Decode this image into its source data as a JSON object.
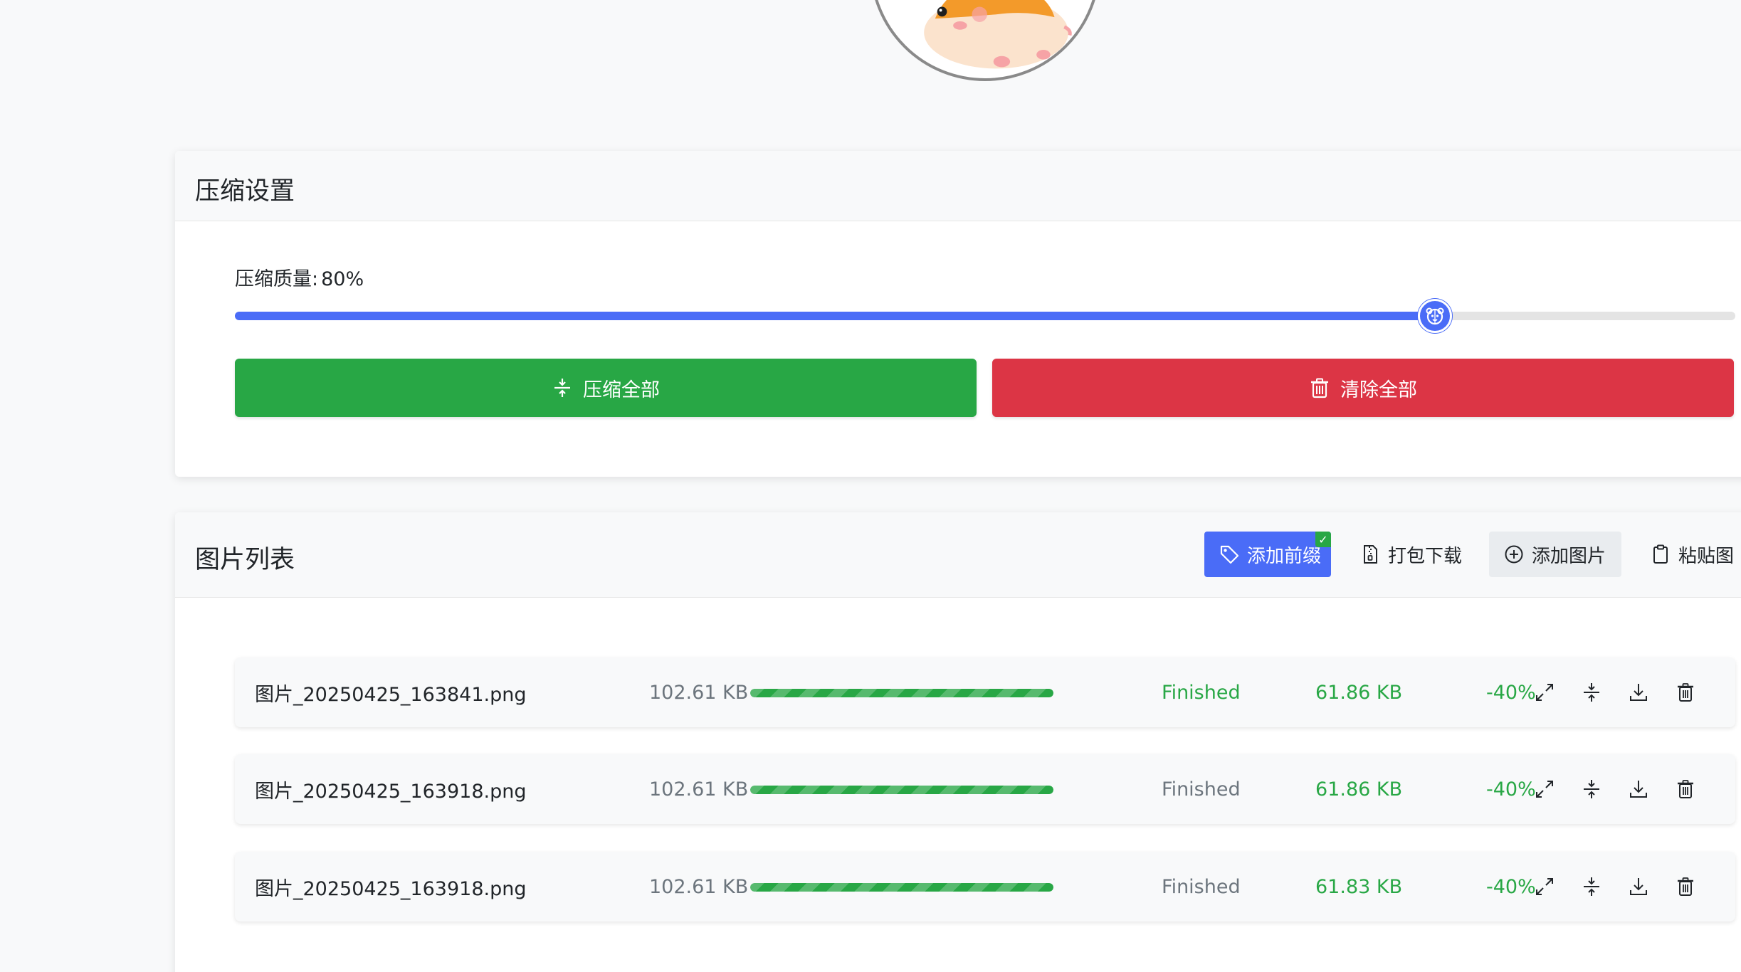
{
  "settings": {
    "title": "压缩设置",
    "quality_label": "压缩质量:",
    "quality_value": "80%",
    "quality_fraction": 0.8,
    "compress_all_label": "压缩全部",
    "clear_all_label": "清除全部"
  },
  "list": {
    "title": "图片列表",
    "toolbar": {
      "add_prefix_label": "添加前缀",
      "add_prefix_checked": "✓",
      "zip_download_label": "打包下载",
      "add_image_label": "添加图片",
      "paste_image_label": "粘贴图"
    },
    "rows": [
      {
        "name": "图片_20250425_163841.png",
        "size": "102.61 KB",
        "progress": 1.0,
        "status": "Finished",
        "status_color": "#28a745",
        "new_size": "61.86 KB",
        "ratio": "-40%"
      },
      {
        "name": "图片_20250425_163918.png",
        "size": "102.61 KB",
        "progress": 1.0,
        "status": "Finished",
        "status_color": "#6c757d",
        "new_size": "61.86 KB",
        "ratio": "-40%"
      },
      {
        "name": "图片_20250425_163918.png",
        "size": "102.61 KB",
        "progress": 1.0,
        "status": "Finished",
        "status_color": "#6c757d",
        "new_size": "61.83 KB",
        "ratio": "-40%"
      }
    ]
  },
  "colors": {
    "primary": "#4a6cf7",
    "success": "#28a745",
    "danger": "#dc3545",
    "muted": "#6c757d"
  },
  "icons": {
    "logo": "hamster-logo",
    "slider_thumb": "hamster-face-icon",
    "compress": "compress-arrows-icon",
    "trash": "trash-icon",
    "tag": "tag-icon",
    "zip": "zip-file-icon",
    "add": "plus-circle-icon",
    "clipboard": "clipboard-icon",
    "expand": "expand-arrows-icon",
    "download": "download-icon"
  }
}
